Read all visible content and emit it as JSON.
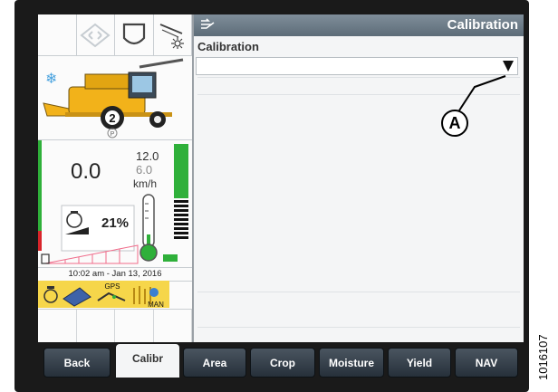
{
  "header": {
    "title": "Calibration"
  },
  "panel": {
    "label": "Calibration"
  },
  "dropdown": {
    "value": ""
  },
  "status": {
    "speed": "0.0",
    "speed_max": "12.0",
    "speed_min": "6.0",
    "speed_unit": "km/h",
    "engine_load": "21%",
    "datetime": "10:02 am - Jan 13, 2016",
    "gear": "2",
    "park": "P",
    "gps_label": "GPS",
    "man_label": "MAN"
  },
  "buttons": [
    {
      "label": "Back"
    },
    {
      "label": "Calibr"
    },
    {
      "label": "Area"
    },
    {
      "label": "Crop"
    },
    {
      "label": "Moisture"
    },
    {
      "label": "Yield"
    },
    {
      "label": "NAV"
    }
  ],
  "callout": {
    "label": "A"
  },
  "figure_number": "1016107",
  "colors": {
    "titlebar": "#6b7a86",
    "gauge_green": "#2fb03a",
    "gauge_red": "#d8242a",
    "machine_yellow": "#f2b21a"
  }
}
